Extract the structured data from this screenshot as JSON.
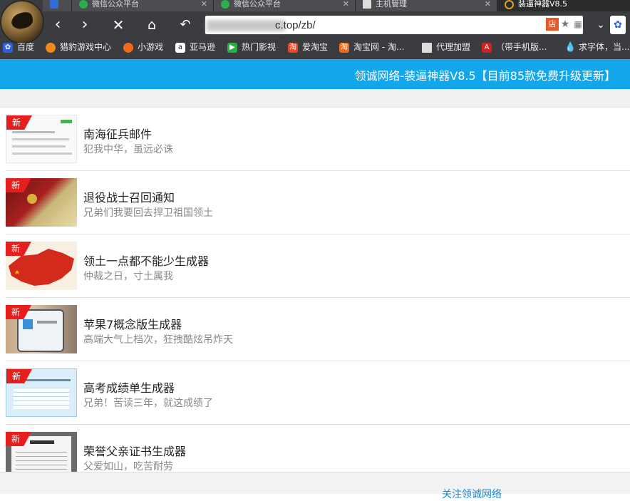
{
  "browser": {
    "tabs": [
      {
        "label": "",
        "icon": "ie-icon"
      },
      {
        "label": "微信公众平台",
        "icon": "wechat-icon"
      },
      {
        "label": "微信公众平台",
        "icon": "wechat-icon"
      },
      {
        "label": "主机管理",
        "icon": "page-icon"
      },
      {
        "label": "装逼神器V8.5",
        "icon": "loading-icon"
      }
    ],
    "address_url": "c.top/zb/",
    "bookmarks": [
      {
        "label": "百度",
        "icon": "baidu-icon",
        "color": "#2b5fe6"
      },
      {
        "label": "猎豹游戏中心",
        "icon": "cheetah-game-icon",
        "color": "#f08a1c"
      },
      {
        "label": "小游戏",
        "icon": "mini-game-icon",
        "color": "#f06a1c"
      },
      {
        "label": "亚马逊",
        "icon": "amazon-icon",
        "color": "#ffffff"
      },
      {
        "label": "热门影视",
        "icon": "video-icon",
        "color": "#2ab04a"
      },
      {
        "label": "爱淘宝",
        "icon": "taobao-icon",
        "color": "#e8452a"
      },
      {
        "label": "淘宝网 - 淘...",
        "icon": "taobao-net-icon",
        "color": "#f06a1c"
      },
      {
        "label": "代理加盟",
        "icon": "page-icon",
        "color": "#dddddd"
      },
      {
        "label": "（带手机版...",
        "icon": "acrobat-icon",
        "color": "#d81e1e"
      },
      {
        "label": "求字体，当...",
        "icon": "drop-icon",
        "color": "#1a7ae0"
      }
    ]
  },
  "banner": {
    "text": "领诚网络-装逼神器V8.5【目前85款免费升级更新】"
  },
  "badge_text": "新",
  "items": [
    {
      "title": "南海征兵邮件",
      "desc": "犯我中华，虽远必诛",
      "thumb": "document-thumb"
    },
    {
      "title": "退役战士召回通知",
      "desc": "兄弟们我要回去捍卫祖国领土",
      "thumb": "passport-thumb"
    },
    {
      "title": "领土一点都不能少生成器",
      "desc": "仲裁之日，寸土属我",
      "thumb": "map-thumb"
    },
    {
      "title": "苹果7概念版生成器",
      "desc": "高端大气上档次，狂拽酷炫吊炸天",
      "thumb": "phone-thumb"
    },
    {
      "title": "高考成绩单生成器",
      "desc": "兄弟！苦读三年，就这成绩了",
      "thumb": "certificate-thumb"
    },
    {
      "title": "荣誉父亲证书生成器",
      "desc": "父爱如山，吃苦耐劳",
      "thumb": "honor-thumb"
    }
  ],
  "footer": {
    "link": "关注领诚网络"
  }
}
